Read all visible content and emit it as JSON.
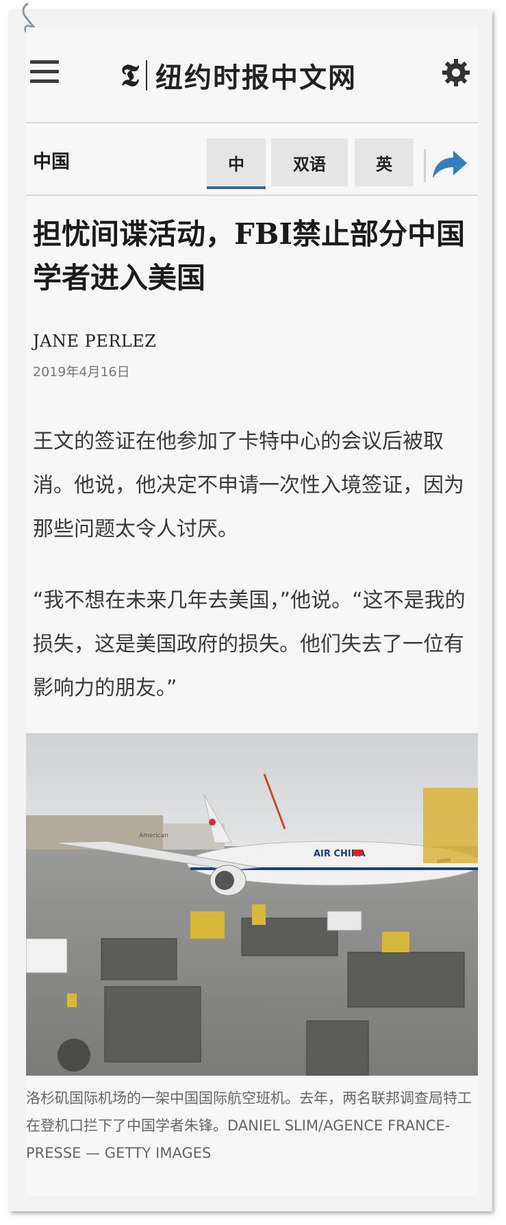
{
  "app": {
    "brand_mark": "𝕿",
    "brand_name": "纽约时报中文网"
  },
  "nav": {
    "section": "中国",
    "languages": [
      "中",
      "双语",
      "英"
    ],
    "active_language": "中"
  },
  "article": {
    "headline": "担忧间谍活动，FBI禁止部分中国学者进入美国",
    "byline": "JANE PERLEZ",
    "date": "2019年4月16日",
    "paragraphs": [
      "王文的签证在他参加了卡特中心的会议后被取消。他说，他决定不申请一次性入境签证，因为那些问题太令人讨厌。",
      "“我不想在未来几年去美国，”他说。“这不是我的损失，这是美国政府的损失。他们失去了一位有影响力的朋友。”"
    ],
    "photo": {
      "airline_text": "AIR CHINA",
      "terminal_sign": "American"
    },
    "caption": "洛杉矶国际机场的一架中国国际航空班机。去年，两名联邦调查局特工在登机口拦下了中国学者朱锋。DANIEL SLIM/AGENCE FRANCE-PRESSE — GETTY IMAGES"
  },
  "colors": {
    "accent": "#326891",
    "share_arrow": "#2f7fc1"
  }
}
